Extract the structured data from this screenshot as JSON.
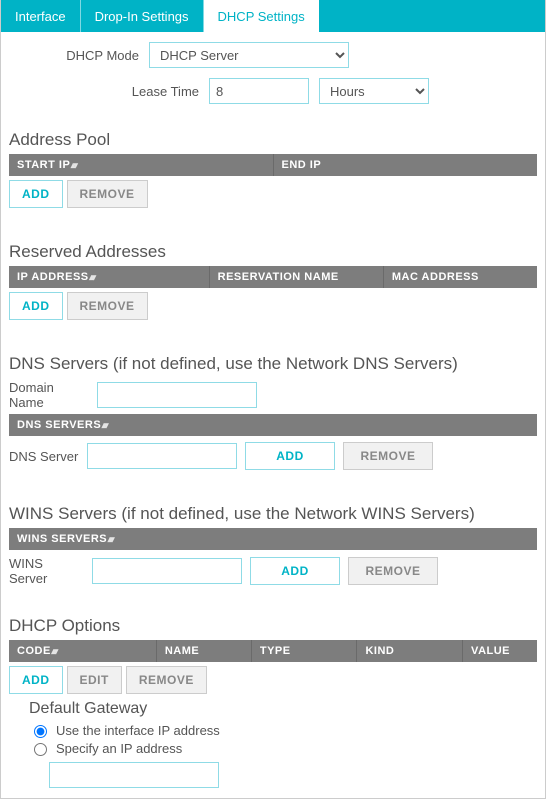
{
  "tabs": {
    "interface": "Interface",
    "dropin": "Drop-In Settings",
    "dhcp": "DHCP Settings"
  },
  "dhcp_mode": {
    "label": "DHCP Mode",
    "value": "DHCP Server"
  },
  "lease_time": {
    "label": "Lease Time",
    "value": "8",
    "unit": "Hours"
  },
  "address_pool": {
    "title": "Address Pool",
    "cols": {
      "start": "Start IP",
      "end": "End IP"
    },
    "add": "ADD",
    "remove": "REMOVE"
  },
  "reserved": {
    "title": "Reserved Addresses",
    "cols": {
      "ip": "IP Address",
      "name": "Reservation Name",
      "mac": "MAC Address"
    },
    "add": "ADD",
    "remove": "REMOVE"
  },
  "dns": {
    "title": "DNS Servers (if not defined, use the Network DNS Servers)",
    "domain_label": "Domain Name",
    "domain_value": "",
    "head": "DNS Servers",
    "row_label": "DNS Server",
    "row_value": "",
    "add": "ADD",
    "remove": "REMOVE"
  },
  "wins": {
    "title": "WINS Servers (if not defined, use the Network WINS Servers)",
    "head": "WINS Servers",
    "row_label": "WINS Server",
    "row_value": "",
    "add": "ADD",
    "remove": "REMOVE"
  },
  "options": {
    "title": "DHCP Options",
    "cols": {
      "code": "Code",
      "name": "Name",
      "type": "Type",
      "kind": "Kind",
      "value": "Value"
    },
    "add": "ADD",
    "edit": "EDIT",
    "remove": "REMOVE"
  },
  "gateway": {
    "title": "Default Gateway",
    "use_iface": "Use the interface IP address",
    "specify": "Specify an IP address",
    "value": ""
  }
}
